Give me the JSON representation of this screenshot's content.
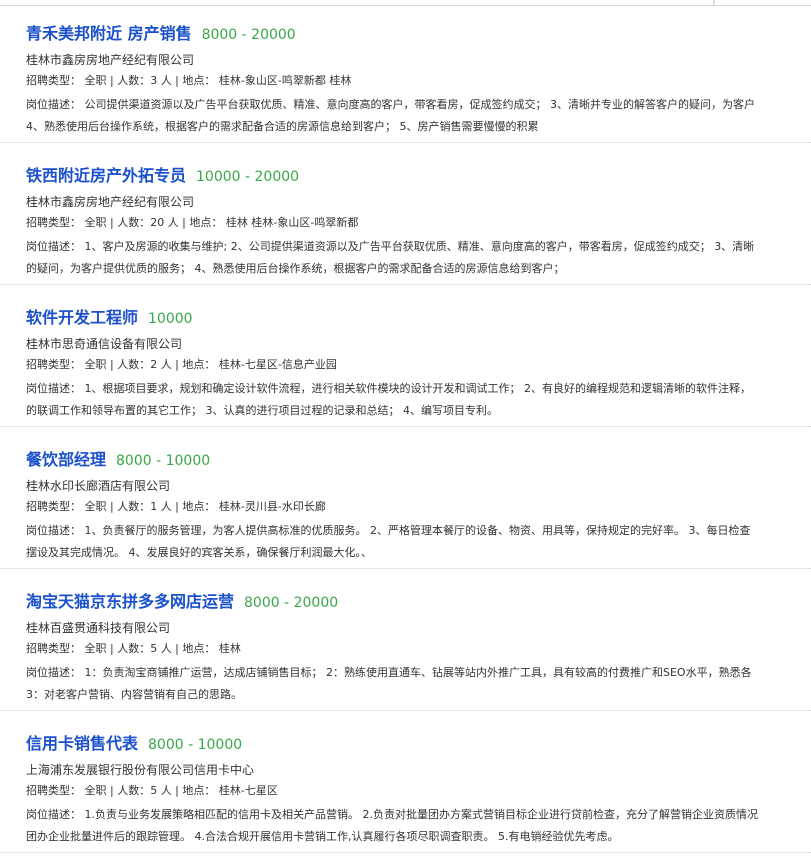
{
  "colors": {
    "title": "#1b51cc",
    "salary": "#3aa64a",
    "text": "#333333",
    "divider": "#d2d2d2"
  },
  "jobs": [
    {
      "title": "青禾美邦附近 房产销售",
      "salary": "8000 - 20000",
      "company": "桂林市鑫房房地产经纪有限公司",
      "meta": "招聘类型： 全职 | 人数：3 人 | 地点： 桂林-象山区-鸣翠新都 桂林",
      "desc_line1": "岗位描述： 公司提供渠道资源以及广告平台获取优质、精准、意向度高的客户，带客看房，促成签约成交； 3、清晰并专业的解答客户的疑问，为客户",
      "desc_line2": "4、熟悉使用后台操作系统，根据客户的需求配备合适的房源信息给到客户； 5、房产销售需要慢慢的积累"
    },
    {
      "title": "铁西附近房产外拓专员",
      "salary": "10000 - 20000",
      "company": "桂林市鑫房房地产经纪有限公司",
      "meta": "招聘类型： 全职 | 人数：20 人 | 地点： 桂林 桂林-象山区-鸣翠新都",
      "desc_line1": "岗位描述： 1、客户及房源的收集与维护; 2、公司提供渠道资源以及广告平台获取优质、精准、意向度高的客户，带客看房，促成签约成交； 3、清晰",
      "desc_line2": "的疑问，为客户提供优质的服务； 4、熟悉使用后台操作系统，根据客户的需求配备合适的房源信息给到客户；"
    },
    {
      "title": "软件开发工程师",
      "salary": "10000",
      "company": "桂林市思奇通信设备有限公司",
      "meta": "招聘类型： 全职 | 人数：2 人 | 地点： 桂林-七星区-信息产业园",
      "desc_line1": "岗位描述： 1、根据项目要求，规划和确定设计软件流程，进行相关软件模块的设计开发和调试工作； 2、有良好的编程规范和逻辑清晰的软件注释，",
      "desc_line2": "的联调工作和领导布置的其它工作； 3、认真的进行项目过程的记录和总结； 4、编写项目专利。"
    },
    {
      "title": "餐饮部经理",
      "salary": "8000 - 10000",
      "company": "桂林水印长廊酒店有限公司",
      "meta": "招聘类型： 全职 | 人数：1 人 | 地点： 桂林-灵川县-水印长廊",
      "desc_line1": "岗位描述： 1、负责餐厅的服务管理，为客人提供高标准的优质服务。 2、严格管理本餐厅的设备、物资、用具等，保持规定的完好率。 3、每日检查",
      "desc_line2": "摆设及其完成情况。 4、发展良好的宾客关系，确保餐厅利润最大化。、"
    },
    {
      "title": "淘宝天猫京东拼多多网店运营",
      "salary": "8000 - 20000",
      "company": "桂林百盛贯通科技有限公司",
      "meta": "招聘类型： 全职 | 人数：5 人 | 地点： 桂林",
      "desc_line1": "岗位描述： 1：负责淘宝商铺推广运营，达成店铺销售目标； 2：熟练使用直通车、钻展等站内外推广工具，具有较高的付费推广和SEO水平，熟悉各",
      "desc_line2": "3：对老客户营销、内容营销有自己的思路。"
    },
    {
      "title": "信用卡销售代表",
      "salary": "8000 - 10000",
      "company": "上海浦东发展银行股份有限公司信用卡中心",
      "meta": "招聘类型： 全职 | 人数：5 人 | 地点： 桂林-七星区",
      "desc_line1": "岗位描述： 1.负责与业务发展策略相匹配的信用卡及相关产品营销。 2.负责对批量团办方案式营销目标企业进行贷前检查，充分了解营销企业资质情况",
      "desc_line2": "团办企业批量进件后的跟踪管理。 4.合法合规开展信用卡营销工作,认真履行各项尽职调查职责。 5.有电销经验优先考虑。"
    }
  ]
}
